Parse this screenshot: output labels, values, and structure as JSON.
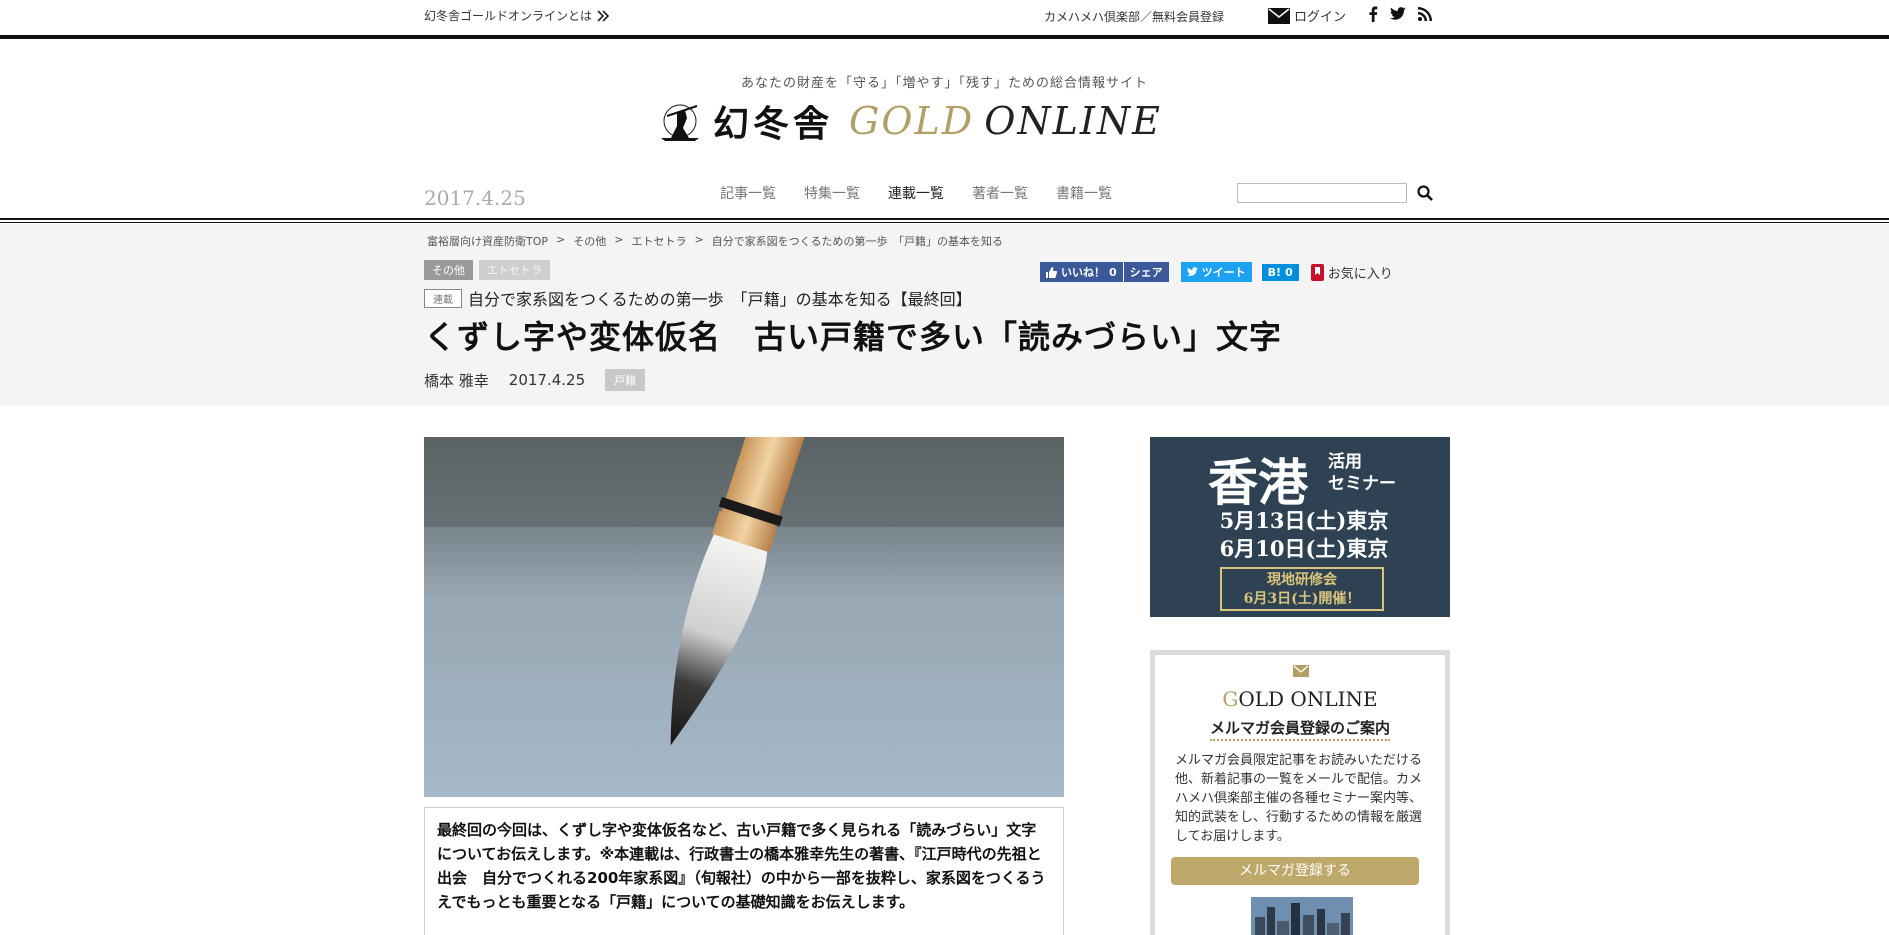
{
  "topbar": {
    "about": "幻冬舎ゴールドオンラインとは",
    "register": "カメハメハ倶楽部／無料会員登録",
    "login": "ログイン",
    "social_icons": [
      "facebook-icon",
      "twitter-icon",
      "rss-icon"
    ]
  },
  "header": {
    "tagline": "あなたの財産を「守る」「増やす」「残す」ための総合情報サイト",
    "logo_kanji": "幻冬舎",
    "logo_gold": "GOLD",
    "logo_online": "ONLINE",
    "date": "2017.4.25"
  },
  "nav": {
    "items": [
      {
        "label": "記事一覧"
      },
      {
        "label": "特集一覧"
      },
      {
        "label": "連載一覧"
      },
      {
        "label": "著者一覧"
      },
      {
        "label": "書籍一覧"
      }
    ]
  },
  "breadcrumb": {
    "items": [
      "富裕層向け資産防衛TOP",
      "その他",
      "エトセトラ",
      "自分で家系図をつくるための第一歩　「戸籍」の基本を知る"
    ],
    "separator": ">"
  },
  "article": {
    "tag_primary": "その他",
    "tag_secondary": "エトセトラ",
    "series_label": "連載",
    "series_title": "自分で家系図をつくるための第一歩　「戸籍」の基本を知る【最終回】",
    "title": "くずし字や変体仮名　古い戸籍で多い「読みづらい」文字",
    "author": "橋本 雅幸",
    "date": "2017.4.25",
    "keyword": "戸籍",
    "lead": "最終回の今回は、くずし字や変体仮名など、古い戸籍で多く見られる「読みづらい」文字についてお伝えします。※本連載は、行政書士の橋本雅幸先生の著書、『江戸時代の先祖と出会　自分でつくれる200年家系図』（旬報社）の中から一部を抜粋し、家系図をつくるうえでもっとも重要となる「戸籍」についての基礎知識をお伝えします。"
  },
  "share": {
    "like": "いいね！",
    "like_count": "0",
    "share": "シェア",
    "tweet": "ツイート",
    "hatena": "B!",
    "hatena_count": "0",
    "favorite": "お気に入り"
  },
  "sidebar": {
    "ad": {
      "big": "香港",
      "sub1": "活用",
      "sub2": "セミナー",
      "date1": "5月13日(土)東京",
      "date2": "6月10日(土)東京",
      "box1": "現地研修会",
      "box2": "6月3日(土)開催！"
    },
    "magazine": {
      "brand_g": "G",
      "brand_rest": "OLD ONLINE",
      "heading": "メルマガ会員登録のご案内",
      "description": "メルマガ会員限定記事をお読みいただける他、新着記事の一覧をメールで配信。カメハメハ倶楽部主催の各種セミナー案内等、知的武装をし、行動するための情報を厳選してお届けします。",
      "button": "メルマガ登録する"
    }
  },
  "colors": {
    "accent_gold": "#b29f66",
    "facebook": "#3b5998",
    "twitter": "#1da1f2",
    "hatena": "#008fde",
    "ad_bg": "#2f4253"
  }
}
